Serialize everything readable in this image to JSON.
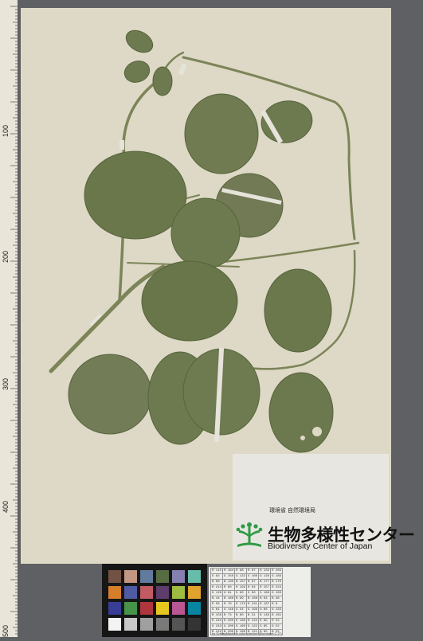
{
  "ruler": {
    "major_labels": [
      "100",
      "200",
      "300",
      "400",
      "500"
    ]
  },
  "colors": {
    "background": "#5e6063",
    "sheet": "#ddd9c6",
    "leaf": "#6d7a4f",
    "stem": "#7c8458",
    "tape": "#e6e3da"
  },
  "label": {
    "ministry": "環境省 自然環境局",
    "center_name_jp": "生物多様性センター",
    "center_name_en": "Biodiversity Center of Japan",
    "logo_icon": "plant-sprout-icon"
  },
  "color_checker": {
    "swatches": [
      "#735244",
      "#c29682",
      "#627a9d",
      "#576c43",
      "#8580b1",
      "#67bdaa",
      "#d67e2c",
      "#505ba6",
      "#c15a63",
      "#5e3c6c",
      "#9dbc40",
      "#e0a32e",
      "#383d96",
      "#469449",
      "#af363c",
      "#e7c71f",
      "#bb5695",
      "#0885a1",
      "#f3f3f2",
      "#c8c8c8",
      "#a0a0a0",
      "#7a7a79",
      "#555555",
      "#343434"
    ],
    "values": [
      [
        "R 115",
        "R 194",
        "R 98",
        "R 87",
        "R 133",
        "R 103"
      ],
      [
        "G 82",
        "G 150",
        "G 122",
        "G 108",
        "G 128",
        "G 189"
      ],
      [
        "B 68",
        "B 130",
        "B 157",
        "B 67",
        "B 177",
        "B 170"
      ],
      [
        "R 214",
        "R 80",
        "R 193",
        "R 94",
        "R 157",
        "R 224"
      ],
      [
        "G 126",
        "G 91",
        "G 90",
        "G 60",
        "G 188",
        "G 163"
      ],
      [
        "B 44",
        "B 166",
        "B 99",
        "B 108",
        "B 64",
        "B 46"
      ],
      [
        "R 56",
        "R 70",
        "R 175",
        "R 231",
        "R 187",
        "R 8"
      ],
      [
        "G 61",
        "G 148",
        "G 54",
        "G 199",
        "G 86",
        "G 133"
      ],
      [
        "B 150",
        "B 73",
        "B 60",
        "B 31",
        "B 149",
        "B 161"
      ],
      [
        "R 243",
        "R 200",
        "R 160",
        "R 122",
        "R 85",
        "R 52"
      ],
      [
        "G 243",
        "G 200",
        "G 160",
        "G 122",
        "G 85",
        "G 52"
      ],
      [
        "B 242",
        "B 200",
        "B 160",
        "B 121",
        "B 85",
        "B 52"
      ]
    ],
    "caption": "by GretagMacbeth color checker (Illuminant C 2°)"
  }
}
